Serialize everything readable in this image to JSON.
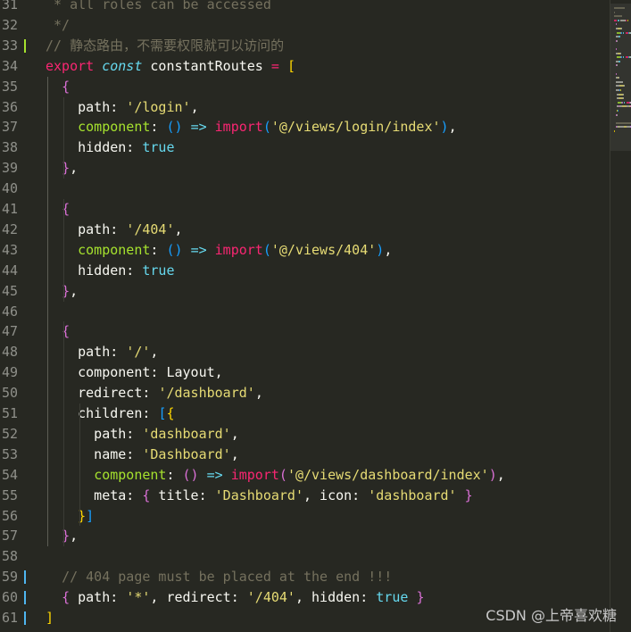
{
  "editor": {
    "language": "javascript",
    "lines": [
      {
        "no": "31",
        "tokens": [
          {
            "t": " * all roles can be accessed",
            "c": "comment"
          }
        ]
      },
      {
        "no": "32",
        "tokens": [
          {
            "t": " */",
            "c": "comment"
          }
        ]
      },
      {
        "no": "33",
        "tokens": [
          {
            "t": "// 静态路由，不需要权限就可以访问的",
            "c": "comment"
          }
        ],
        "diff": "added"
      },
      {
        "no": "34",
        "tokens": [
          {
            "t": "export",
            "c": "keyword"
          },
          {
            "t": " "
          },
          {
            "t": "const",
            "c": "storage"
          },
          {
            "t": " constantRoutes "
          },
          {
            "t": "=",
            "c": "operator"
          },
          {
            "t": " "
          },
          {
            "t": "[",
            "c": "bracket-1"
          }
        ]
      },
      {
        "no": "35",
        "tokens": [
          {
            "t": "  "
          },
          {
            "t": "{",
            "c": "bracket-2"
          }
        ]
      },
      {
        "no": "36",
        "tokens": [
          {
            "t": "    path: "
          },
          {
            "t": "'/login'",
            "c": "string"
          },
          {
            "t": ","
          }
        ]
      },
      {
        "no": "37",
        "tokens": [
          {
            "t": "    "
          },
          {
            "t": "component",
            "c": "func"
          },
          {
            "t": ": "
          },
          {
            "t": "()",
            "c": "bracket-3"
          },
          {
            "t": " "
          },
          {
            "t": "=>",
            "c": "storage"
          },
          {
            "t": " "
          },
          {
            "t": "import",
            "c": "keyword"
          },
          {
            "t": "(",
            "c": "bracket-3"
          },
          {
            "t": "'@/views/login/index'",
            "c": "string"
          },
          {
            "t": ")",
            "c": "bracket-3"
          },
          {
            "t": ","
          }
        ]
      },
      {
        "no": "38",
        "tokens": [
          {
            "t": "    hidden: "
          },
          {
            "t": "true",
            "c": "const"
          }
        ]
      },
      {
        "no": "39",
        "tokens": [
          {
            "t": "  "
          },
          {
            "t": "}",
            "c": "bracket-2"
          },
          {
            "t": ","
          }
        ]
      },
      {
        "no": "40",
        "tokens": []
      },
      {
        "no": "41",
        "tokens": [
          {
            "t": "  "
          },
          {
            "t": "{",
            "c": "bracket-2"
          }
        ]
      },
      {
        "no": "42",
        "tokens": [
          {
            "t": "    path: "
          },
          {
            "t": "'/404'",
            "c": "string"
          },
          {
            "t": ","
          }
        ]
      },
      {
        "no": "43",
        "tokens": [
          {
            "t": "    "
          },
          {
            "t": "component",
            "c": "func"
          },
          {
            "t": ": "
          },
          {
            "t": "()",
            "c": "bracket-3"
          },
          {
            "t": " "
          },
          {
            "t": "=>",
            "c": "storage"
          },
          {
            "t": " "
          },
          {
            "t": "import",
            "c": "keyword"
          },
          {
            "t": "(",
            "c": "bracket-3"
          },
          {
            "t": "'@/views/404'",
            "c": "string"
          },
          {
            "t": ")",
            "c": "bracket-3"
          },
          {
            "t": ","
          }
        ]
      },
      {
        "no": "44",
        "tokens": [
          {
            "t": "    hidden: "
          },
          {
            "t": "true",
            "c": "const"
          }
        ]
      },
      {
        "no": "45",
        "tokens": [
          {
            "t": "  "
          },
          {
            "t": "}",
            "c": "bracket-2"
          },
          {
            "t": ","
          }
        ]
      },
      {
        "no": "46",
        "tokens": []
      },
      {
        "no": "47",
        "tokens": [
          {
            "t": "  "
          },
          {
            "t": "{",
            "c": "bracket-2"
          }
        ]
      },
      {
        "no": "48",
        "tokens": [
          {
            "t": "    path: "
          },
          {
            "t": "'/'",
            "c": "string"
          },
          {
            "t": ","
          }
        ]
      },
      {
        "no": "49",
        "tokens": [
          {
            "t": "    component: Layout,"
          }
        ]
      },
      {
        "no": "50",
        "tokens": [
          {
            "t": "    redirect: "
          },
          {
            "t": "'/dashboard'",
            "c": "string"
          },
          {
            "t": ","
          }
        ]
      },
      {
        "no": "51",
        "tokens": [
          {
            "t": "    children: "
          },
          {
            "t": "[",
            "c": "bracket-3"
          },
          {
            "t": "{",
            "c": "bracket-1"
          }
        ]
      },
      {
        "no": "52",
        "tokens": [
          {
            "t": "      path: "
          },
          {
            "t": "'dashboard'",
            "c": "string"
          },
          {
            "t": ","
          }
        ]
      },
      {
        "no": "53",
        "tokens": [
          {
            "t": "      name: "
          },
          {
            "t": "'Dashboard'",
            "c": "string"
          },
          {
            "t": ","
          }
        ]
      },
      {
        "no": "54",
        "tokens": [
          {
            "t": "      "
          },
          {
            "t": "component",
            "c": "func"
          },
          {
            "t": ": "
          },
          {
            "t": "()",
            "c": "bracket-2"
          },
          {
            "t": " "
          },
          {
            "t": "=>",
            "c": "storage"
          },
          {
            "t": " "
          },
          {
            "t": "import",
            "c": "keyword"
          },
          {
            "t": "(",
            "c": "bracket-2"
          },
          {
            "t": "'@/views/dashboard/index'",
            "c": "string"
          },
          {
            "t": ")",
            "c": "bracket-2"
          },
          {
            "t": ","
          }
        ]
      },
      {
        "no": "55",
        "tokens": [
          {
            "t": "      meta: "
          },
          {
            "t": "{",
            "c": "bracket-2"
          },
          {
            "t": " title: "
          },
          {
            "t": "'Dashboard'",
            "c": "string"
          },
          {
            "t": ", icon: "
          },
          {
            "t": "'dashboard'",
            "c": "string"
          },
          {
            "t": " "
          },
          {
            "t": "}",
            "c": "bracket-2"
          }
        ]
      },
      {
        "no": "56",
        "tokens": [
          {
            "t": "    "
          },
          {
            "t": "}",
            "c": "bracket-1"
          },
          {
            "t": "]",
            "c": "bracket-3"
          }
        ]
      },
      {
        "no": "57",
        "tokens": [
          {
            "t": "  "
          },
          {
            "t": "}",
            "c": "bracket-2"
          },
          {
            "t": ","
          }
        ]
      },
      {
        "no": "58",
        "tokens": []
      },
      {
        "no": "59",
        "tokens": [
          {
            "t": "  "
          },
          {
            "t": "// 404 page must be placed at the end !!!",
            "c": "comment"
          }
        ],
        "diff": "modified"
      },
      {
        "no": "60",
        "tokens": [
          {
            "t": "  "
          },
          {
            "t": "{",
            "c": "bracket-2"
          },
          {
            "t": " path: "
          },
          {
            "t": "'*'",
            "c": "string"
          },
          {
            "t": ", redirect: "
          },
          {
            "t": "'/404'",
            "c": "string"
          },
          {
            "t": ", hidden: "
          },
          {
            "t": "true",
            "c": "const"
          },
          {
            "t": " "
          },
          {
            "t": "}",
            "c": "bracket-2"
          }
        ],
        "diff": "modified"
      },
      {
        "no": "61",
        "tokens": [
          {
            "t": "]",
            "c": "bracket-1"
          }
        ],
        "diff": "modified"
      }
    ]
  },
  "watermark": "CSDN @上帝喜欢糖",
  "colors": {
    "background": "#272822",
    "comment": "#75715e",
    "keyword": "#f92672",
    "string": "#e6db74",
    "function": "#a6e22e",
    "constant": "#66d9ef",
    "diff_added": "#A6E22E",
    "diff_modified": "#4FB6F0"
  }
}
